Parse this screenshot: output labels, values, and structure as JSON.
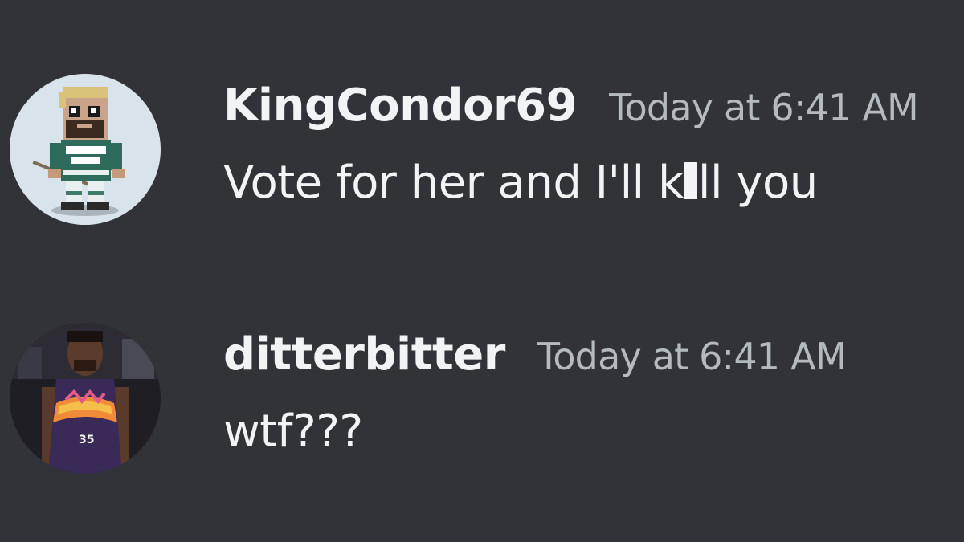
{
  "messages": [
    {
      "username": "KingCondor69",
      "timestamp": "Today at 6:41 AM",
      "text_before": "Vote for her and I'll k",
      "text_after": "ll you",
      "avatar": "pixel-character-avatar-icon"
    },
    {
      "username": "ditterbitter",
      "timestamp": "Today at 6:41 AM",
      "text": "wtf???",
      "avatar": "basketball-player-avatar-icon",
      "jersey_number": "35"
    }
  ],
  "colors": {
    "background": "#313338",
    "username": "#f2f3f5",
    "timestamp": "#b5bac1",
    "message_text": "#f2f3f5"
  }
}
